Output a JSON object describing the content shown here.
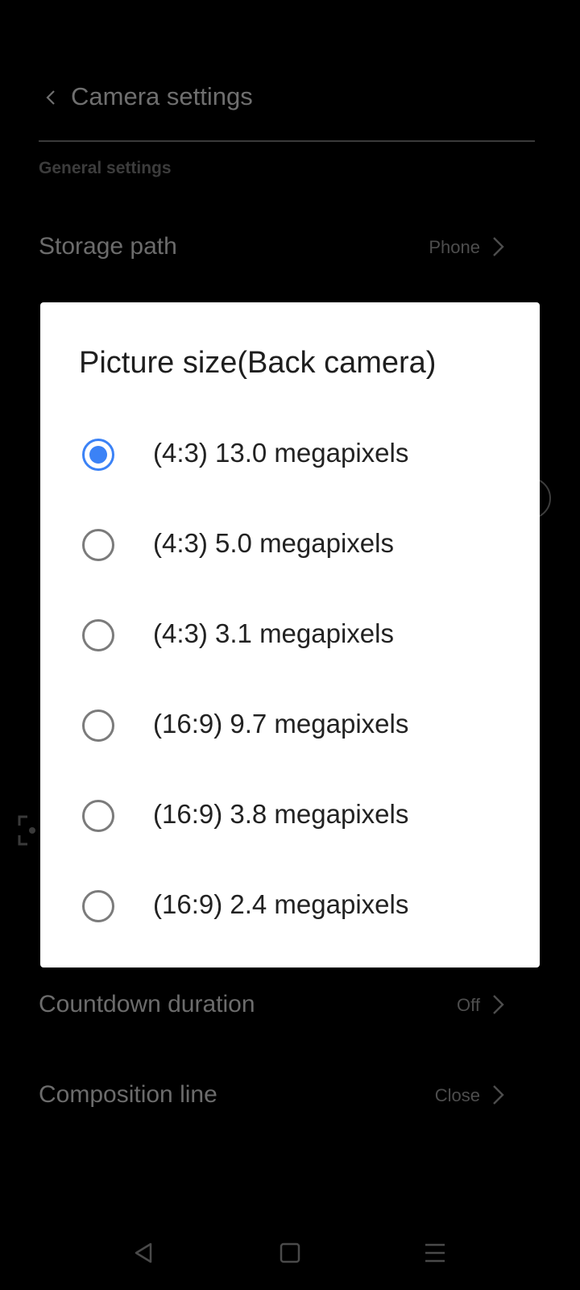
{
  "header": {
    "title": "Camera settings"
  },
  "sections": {
    "general_title": "General settings"
  },
  "settings": [
    {
      "label": "Storage path",
      "value": "Phone"
    },
    {
      "label": "Countdown duration",
      "value": "Off"
    },
    {
      "label": "Composition line",
      "value": "Close"
    }
  ],
  "dialog": {
    "title": "Picture size(Back camera)",
    "selected_index": 0,
    "options": [
      {
        "label": "(4:3) 13.0 megapixels",
        "selected": true
      },
      {
        "label": "(4:3) 5.0 megapixels",
        "selected": false
      },
      {
        "label": "(4:3) 3.1 megapixels",
        "selected": false
      },
      {
        "label": "(16:9) 9.7 megapixels",
        "selected": false
      },
      {
        "label": "(16:9) 3.8 megapixels",
        "selected": false
      },
      {
        "label": "(16:9) 2.4 megapixels",
        "selected": false
      }
    ]
  },
  "icons": {
    "back": "chevron-left-icon",
    "row_arrow": "chevron-right-icon",
    "nav_back": "nav-back-icon",
    "nav_home": "nav-home-icon",
    "nav_recents": "nav-menu-icon"
  },
  "colors": {
    "accent": "#3b82f6",
    "background": "#000000",
    "dialog_background": "#ffffff"
  }
}
